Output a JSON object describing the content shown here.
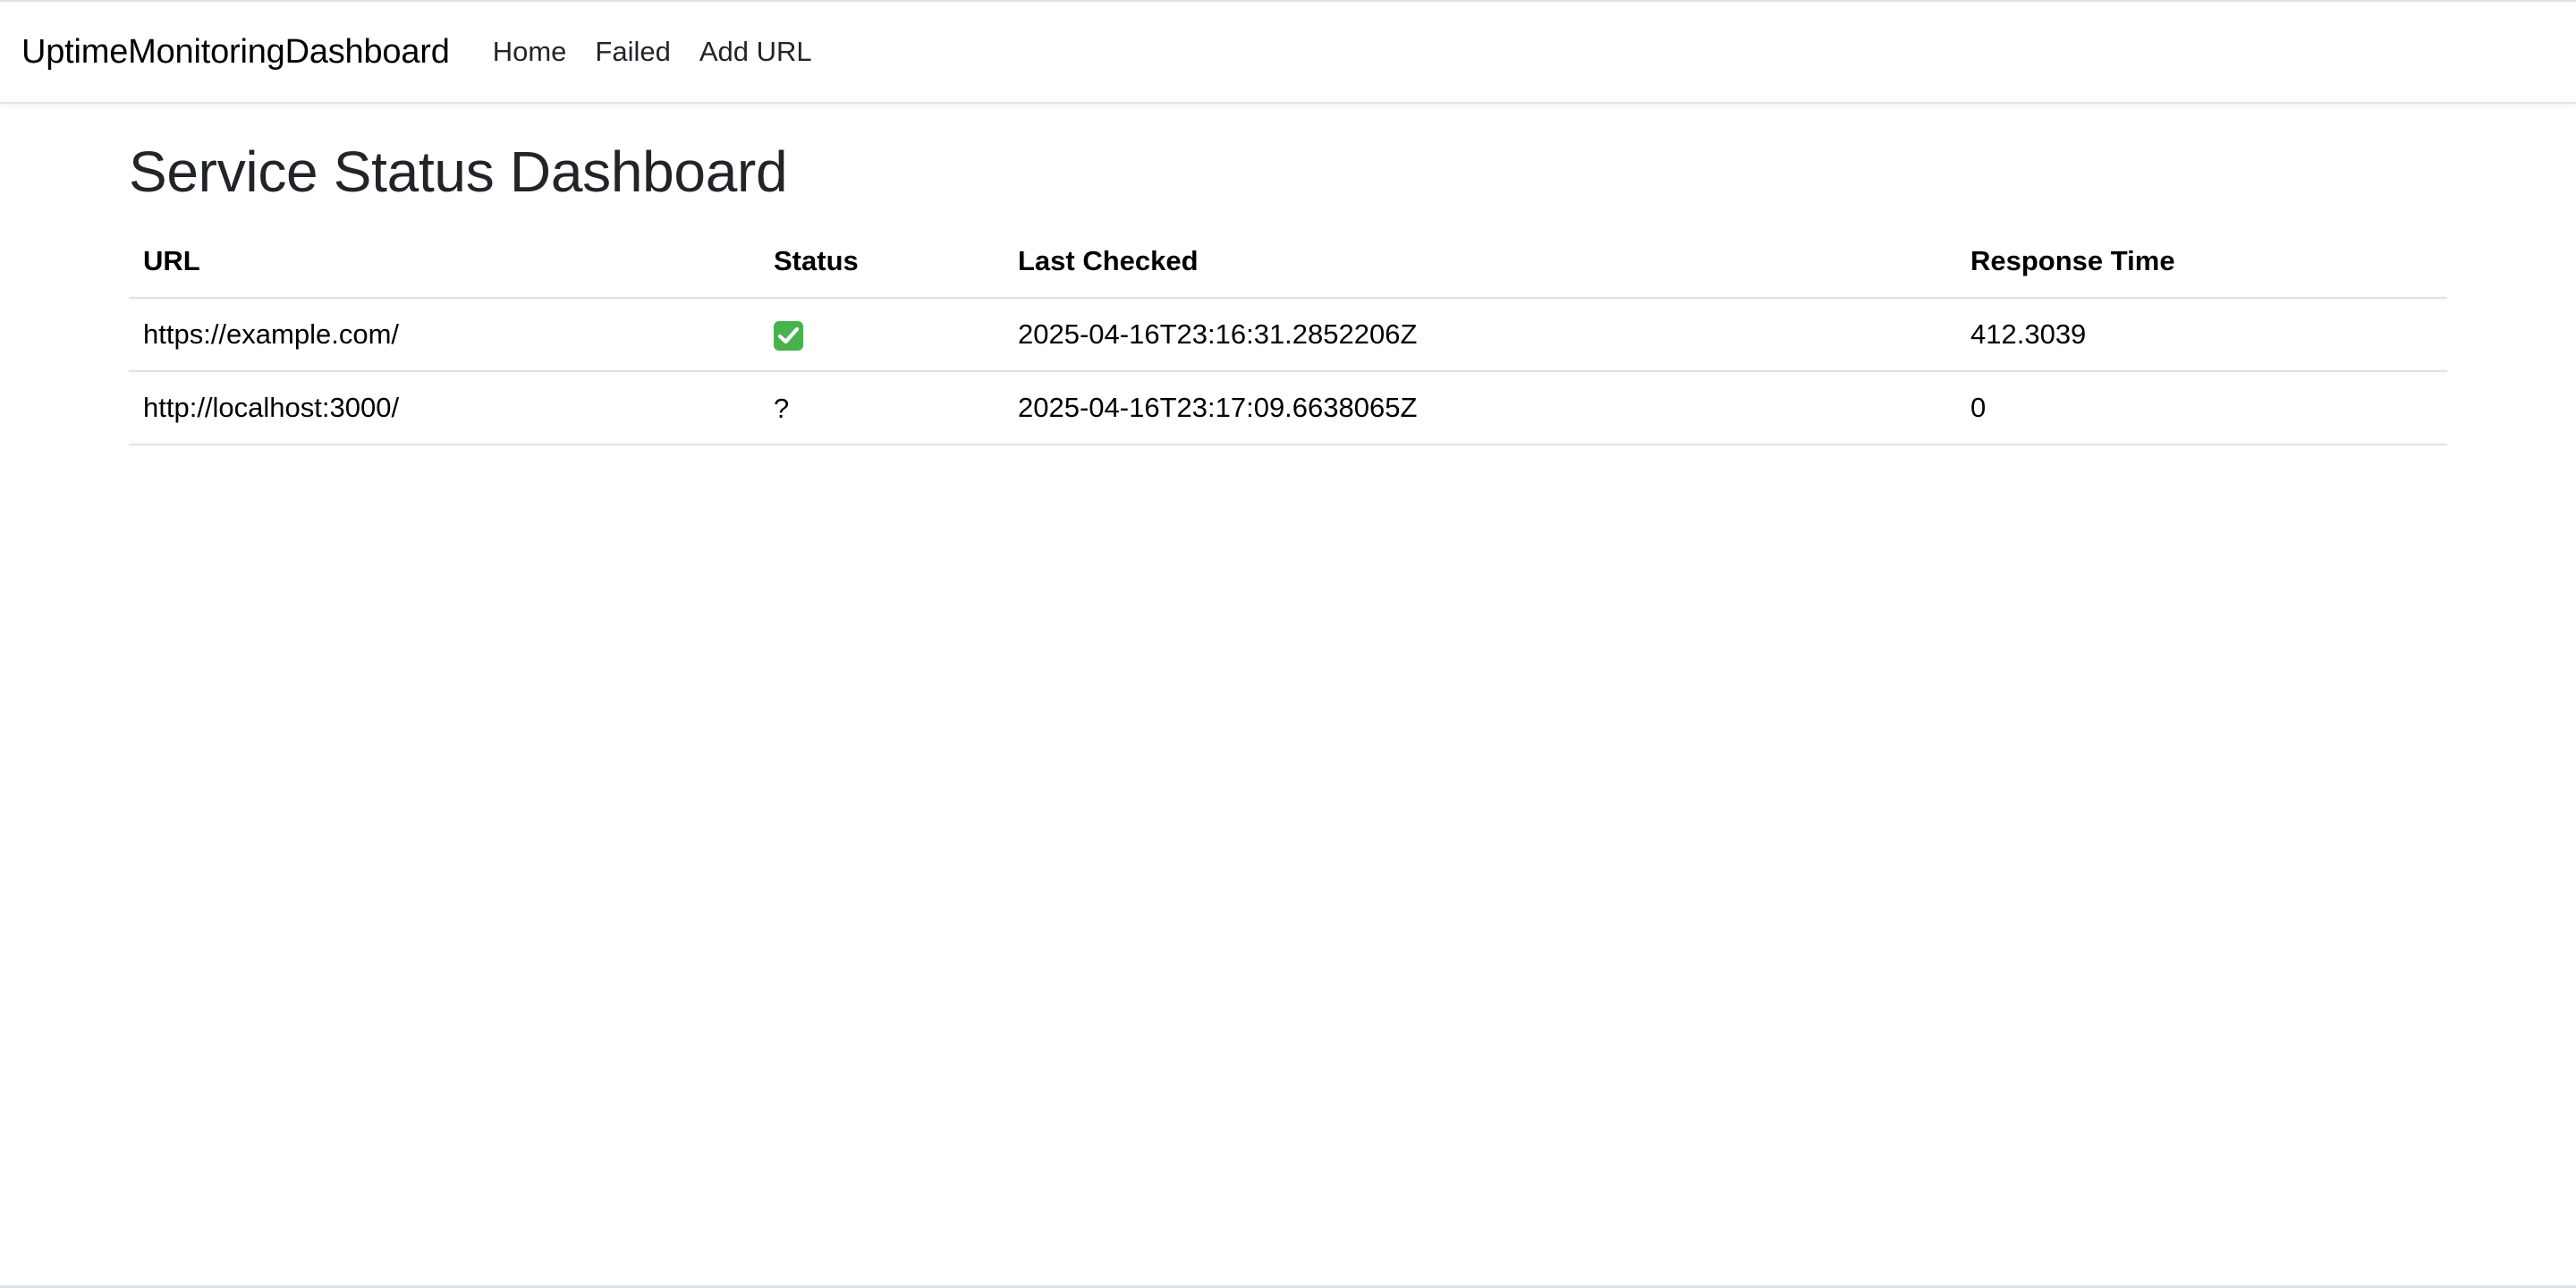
{
  "navbar": {
    "brand": "UptimeMonitoringDashboard",
    "links": [
      "Home",
      "Failed",
      "Add URL"
    ]
  },
  "main": {
    "title": "Service Status Dashboard",
    "table": {
      "headers": [
        "URL",
        "Status",
        "Last Checked",
        "Response Time"
      ],
      "rows": [
        {
          "url": "https://example.com/",
          "status": "up",
          "status_icon": "green-checkmark-icon",
          "last_checked": "2025-04-16T23:16:31.2852206Z",
          "response_time": "412.3039"
        },
        {
          "url": "http://localhost:3000/",
          "status": "?",
          "last_checked": "2025-04-16T23:17:09.6638065Z",
          "response_time": "0"
        }
      ]
    }
  },
  "colors": {
    "status_up": "#48b24f",
    "table_border": "#dee2e6",
    "text": "#212529"
  }
}
